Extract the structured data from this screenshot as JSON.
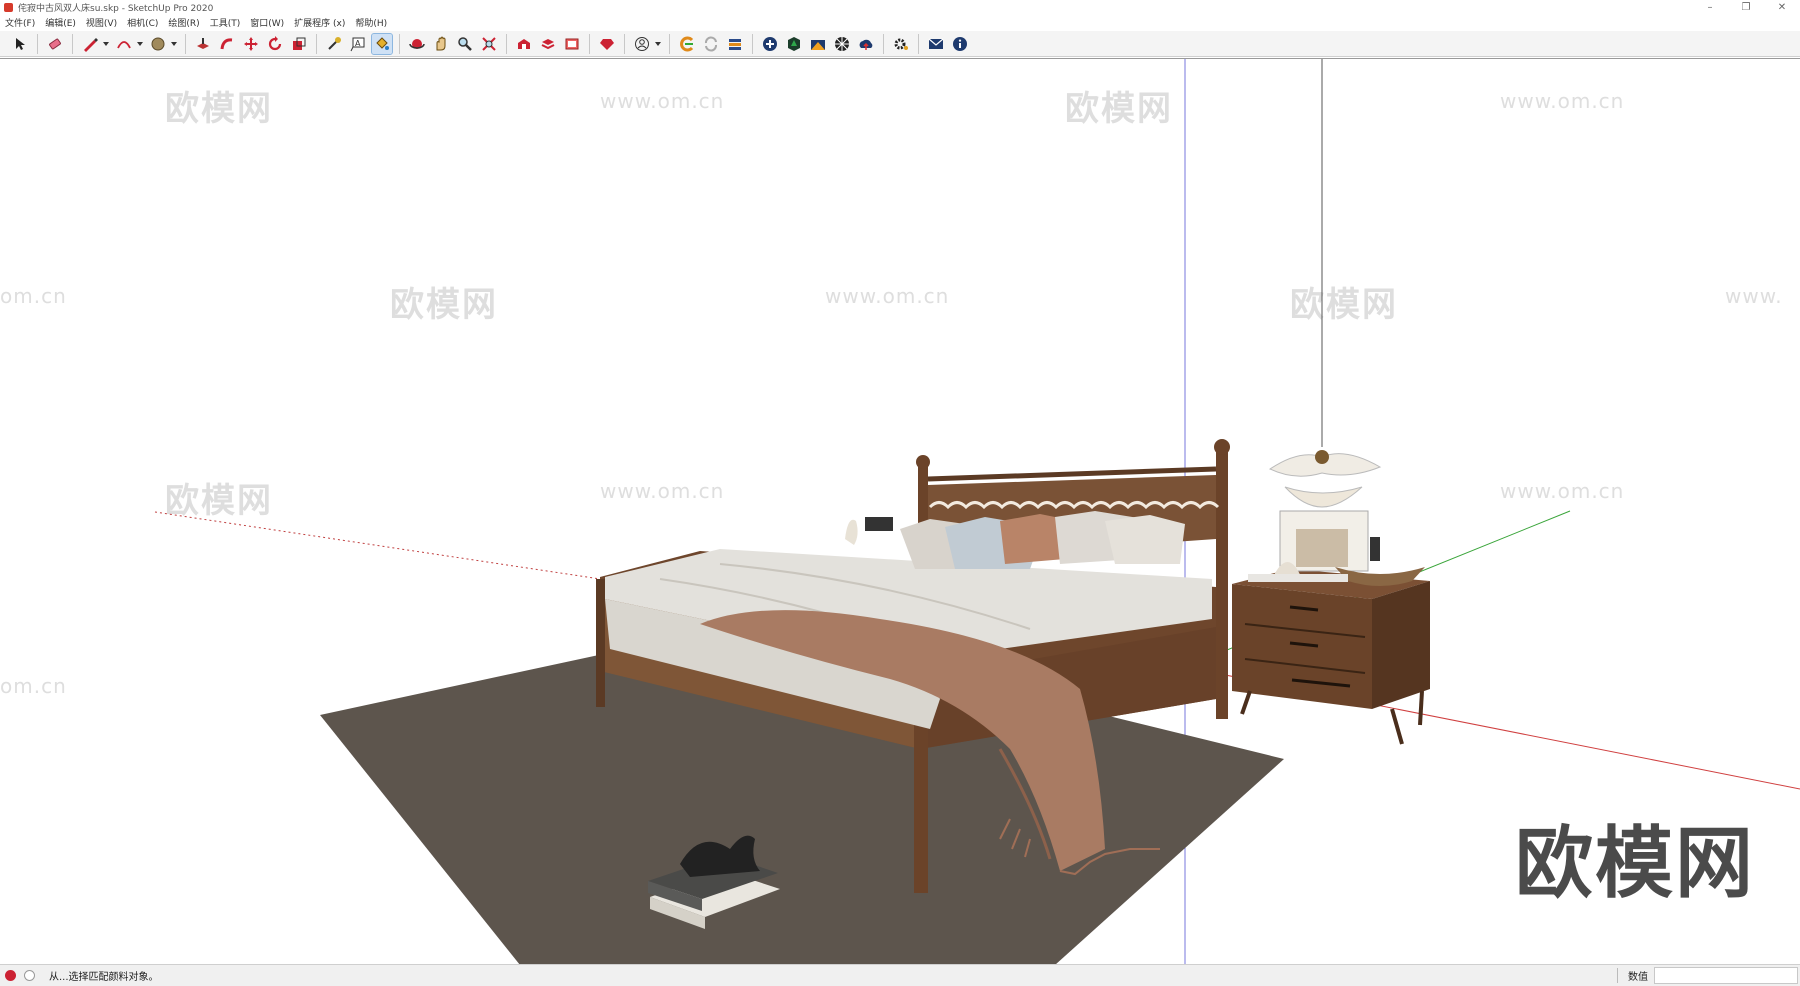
{
  "window": {
    "title": "侘寂中古风双人床su.skp - SketchUp Pro 2020",
    "controls": [
      "–",
      "❐",
      "✕"
    ]
  },
  "menu": [
    "文件(F)",
    "编辑(E)",
    "视图(V)",
    "相机(C)",
    "绘图(R)",
    "工具(T)",
    "窗口(W)",
    "扩展程序 (x)",
    "帮助(H)"
  ],
  "toolbar": {
    "icons": [
      "select-icon",
      "eraser-icon",
      "pencil-line-icon",
      "arc-icon",
      "shape-icon",
      "push-pull-icon",
      "follow-me-icon",
      "move-icon",
      "rotate-icon",
      "scale-icon",
      "tape-measure-icon",
      "text-icon",
      "paint-bucket-icon",
      "orbit-icon",
      "pan-icon",
      "zoom-icon",
      "zoom-extents-icon",
      "warehouse-icon",
      "extension-warehouse-icon",
      "layout-icon",
      "ruby-icon",
      "account-icon",
      "extension-icon-1",
      "extension-icon-2",
      "extension-icon-3",
      "extension-icon-4",
      "extension-icon-5",
      "extension-icon-6",
      "extension-icon-7",
      "extension-icon-8",
      "settings-icon",
      "mail-icon",
      "info-icon"
    ],
    "active_tool": "paint-bucket-icon"
  },
  "viewport": {
    "watermark_text": "欧模网",
    "watermark_url": "www.om.cn",
    "brand_text": "欧模网",
    "url_fragment_left": "om.cn",
    "url_fragment_right": "www."
  },
  "status": {
    "message": "从...选择匹配颜料对象。",
    "measurements_label": "数值",
    "measurements_value": ""
  },
  "colors": {
    "axis_red": "#d04040",
    "axis_green": "#3aa53a",
    "axis_blue": "#4a4ad0",
    "rug": "#5d554d",
    "wood": "#7a5236",
    "wood_dark": "#5b3a24",
    "sheet": "#e3e1dc",
    "throw": "#a97b63"
  }
}
